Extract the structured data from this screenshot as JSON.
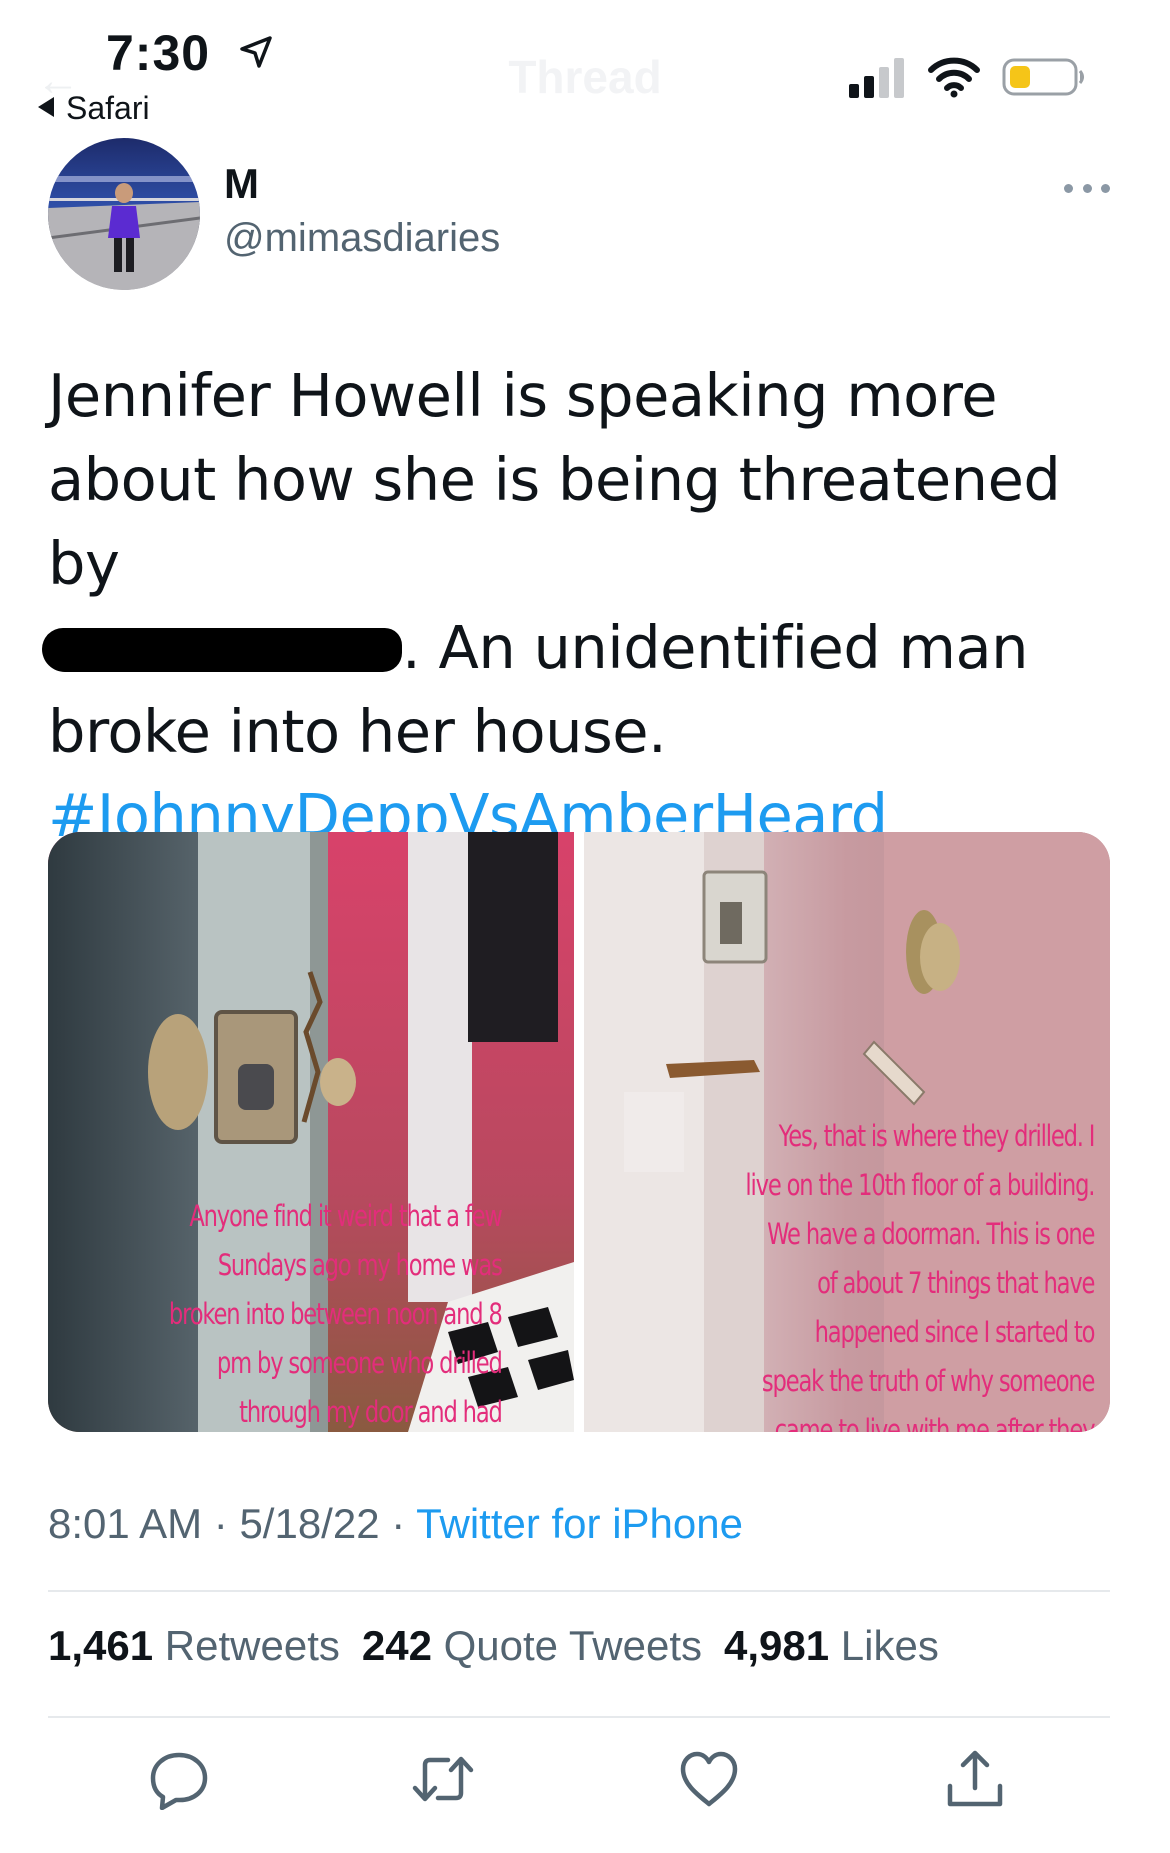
{
  "status_bar": {
    "time": "7:30",
    "back_app": "Safari",
    "ghost_title": "Thread"
  },
  "tweet": {
    "author_name": "M",
    "author_handle": "@mimasdiaries",
    "text_line1": "Jennifer Howell is speaking more",
    "text_line2": "about how she is being threatened by",
    "text_line3_after_redaction": ". An unidentified man",
    "text_line4": "broke into her house.",
    "hashtag": "#JohnnyDeppVsAmberHeard",
    "image_left_caption": "Anyone find it weird that a few\nSundays ago my home was\nbroken into between noon and 8\npm by someone who drilled\nthrough my door and had",
    "image_right_caption": "Yes, that is where they drilled. I\nlive on the 10th floor of a building.\nWe have a doorman. This is one\nof about 7 things that have\nhappened since I started to\nspeak the truth of why someone\ncame to live with me after they",
    "time": "8:01 AM",
    "date": "5/18/22",
    "source": "Twitter for iPhone",
    "retweets_count": "1,461",
    "retweets_label": "Retweets",
    "quotes_count": "242",
    "quotes_label": "Quote Tweets",
    "likes_count": "4,981",
    "likes_label": "Likes"
  },
  "colors": {
    "link": "#1d9bf0",
    "muted": "#536471",
    "overlay_text": "#e32d7b",
    "battery": "#f5c518"
  },
  "icons": [
    "location-arrow-icon",
    "signal-icon",
    "wifi-icon",
    "battery-icon",
    "more-icon",
    "reply-icon",
    "retweet-icon",
    "like-icon",
    "share-icon"
  ]
}
